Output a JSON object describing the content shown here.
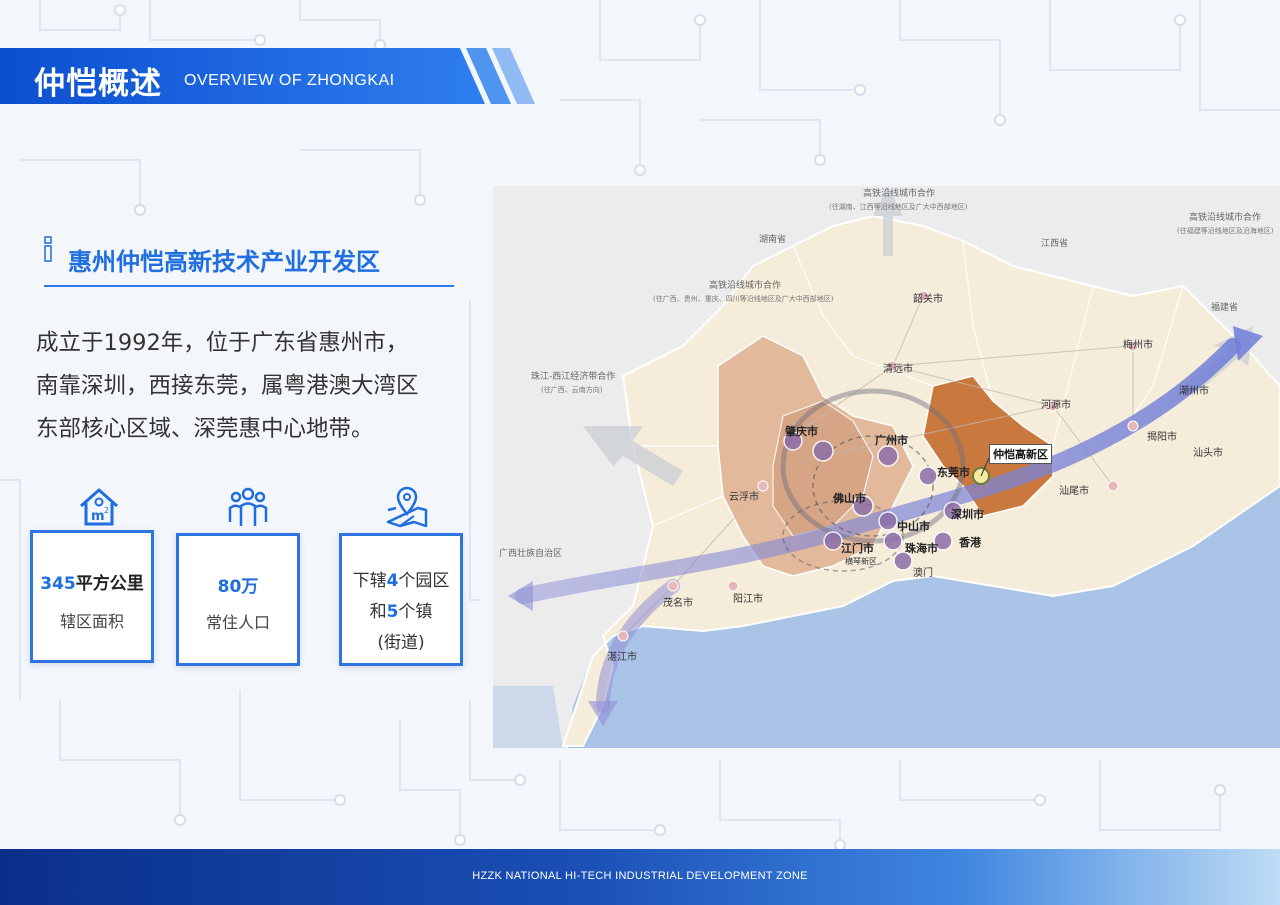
{
  "header": {
    "title_cn": "仲恺概述",
    "title_en": "OVERVIEW OF ZHONGKAI"
  },
  "subtitle": "惠州仲恺高新技术产业开发区",
  "description": [
    "成立于1992年，位于广东省惠州市，",
    "南靠深圳，西接东莞，属粤港澳大湾区",
    "东部核心区域、深莞惠中心地带。"
  ],
  "stats": [
    {
      "icon": "house-area-icon",
      "value": "345",
      "unit": "平方公里",
      "label": "辖区面积"
    },
    {
      "icon": "population-icon",
      "value": "80万",
      "label": "常住人口"
    },
    {
      "icon": "location-map-icon",
      "line1_prefix": "下辖",
      "parks": "4",
      "line1_suffix": "个园区",
      "line2_prefix": "和",
      "towns": "5",
      "line2_suffix": "个镇",
      "line3": "(街道)"
    }
  ],
  "map": {
    "regions": {
      "hunan": "湖南省",
      "jiangxi": "江西省",
      "fujian": "福建省",
      "guangxi": "广西壮族自治区"
    },
    "cooperation": {
      "north_title": "高铁沿线城市合作",
      "north_sub": "(往湖南、江西等沿线地区及广大中西部地区)",
      "northwest_title": "高铁沿线城市合作",
      "northwest_sub": "(往广西、贵州、重庆、四川等沿线地区及广大中西部地区)",
      "west_title": "珠江-西江经济带合作",
      "west_sub": "(往广西、云南方向)",
      "east_title": "高铁沿线城市合作",
      "east_sub": "(往福建等沿线地区及沿海地区)"
    },
    "cities": {
      "shaoguan": "韶关市",
      "qingyuan": "清远市",
      "meizhou": "梅州市",
      "heyuan": "河源市",
      "chaozhou": "潮州市",
      "jieyang": "揭阳市",
      "shantou": "汕头市",
      "shanwei": "汕尾市",
      "yunfu": "云浮市",
      "maoming": "茂名市",
      "yangjiang": "阳江市",
      "zhanjiang": "湛江市",
      "zhaoqing": "肇庆市",
      "guangzhou": "广州市",
      "dongguan": "东莞市",
      "foshan": "佛山市",
      "zhongshan": "中山市",
      "shenzhen": "深圳市",
      "jiangmen": "江门市",
      "zhuhai": "珠海市",
      "hongkong": "香港",
      "macau": "澳门",
      "hengqin": "横琴新区"
    },
    "highlight": "仲恺高新区"
  },
  "footer": "HZZK NATIONAL HI-TECH INDUSTRIAL DEVELOPMENT ZONE",
  "colors": {
    "brand_blue": "#1e6ee0",
    "highlight_orange": "#d07a3a",
    "sea": "#a9c4e6",
    "land": "#f5ecd9"
  }
}
